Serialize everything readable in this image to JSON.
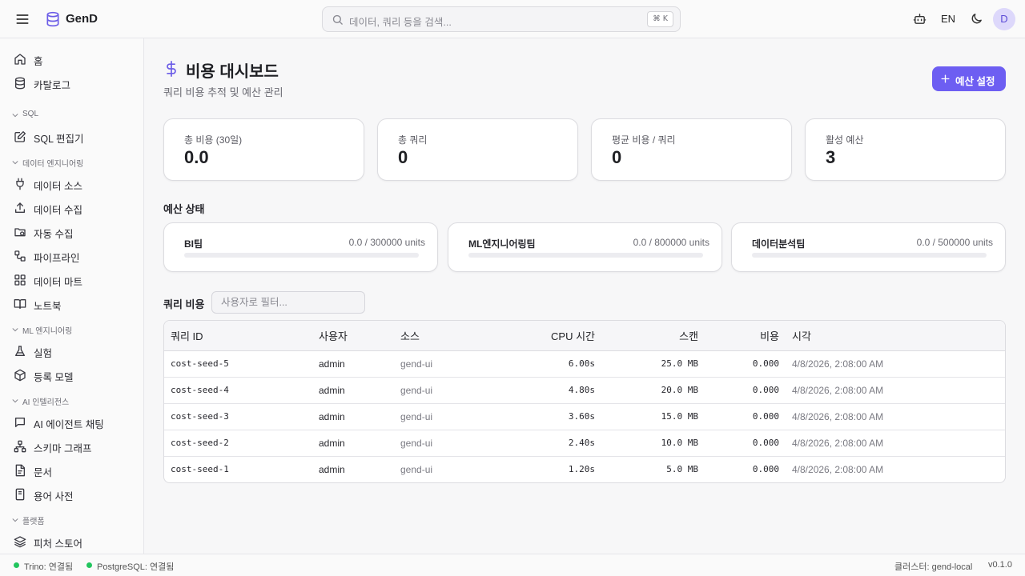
{
  "app": {
    "name": "GenD"
  },
  "search": {
    "placeholder": "데이터, 쿼리 등을 검색...",
    "shortcut": "⌘ K"
  },
  "header": {
    "language": "EN",
    "avatar_initial": "D"
  },
  "sidebar": {
    "home": "홈",
    "catalog": "카탈로그",
    "sections": {
      "sql": "SQL",
      "data_eng": "데이터 엔지니어링",
      "ml_eng": "ML 엔지니어링",
      "ai": "AI 인텔리전스",
      "platform": "플랫폼"
    },
    "sql_editor": "SQL 편집기",
    "data_sources": "데이터 소스",
    "data_ingest": "데이터 수집",
    "auto_ingest": "자동 수집",
    "pipelines": "파이프라인",
    "data_marts": "데이터 마트",
    "notebooks": "노트북",
    "experiments": "실험",
    "registered_models": "등록 모델",
    "ai_agent_chat": "AI 에이전트 채팅",
    "schema_graph": "스키마 그래프",
    "documents": "문서",
    "glossary": "용어 사전",
    "feature_store": "피처 스토어"
  },
  "page": {
    "title": "비용 대시보드",
    "subtitle": "쿼리 비용 추적 및 예산 관리",
    "budget_button": "예산 설정"
  },
  "stats": [
    {
      "label": "총 비용 (30일)",
      "value": "0.0"
    },
    {
      "label": "총 쿼리",
      "value": "0"
    },
    {
      "label": "평균 비용 / 쿼리",
      "value": "0"
    },
    {
      "label": "활성 예산",
      "value": "3"
    }
  ],
  "budget_section": {
    "title": "예산 상태",
    "budgets": [
      {
        "name": "BI팀",
        "usage": "0.0 / 300000 units",
        "fraction": 0.0
      },
      {
        "name": "ML엔지니어링팀",
        "usage": "0.0 / 800000 units",
        "fraction": 0.0
      },
      {
        "name": "데이터분석팀",
        "usage": "0.0 / 500000 units",
        "fraction": 0.0
      }
    ]
  },
  "query_costs": {
    "title": "쿼리 비용",
    "filter_placeholder": "사용자로 필터...",
    "columns": [
      "쿼리 ID",
      "사용자",
      "소스",
      "CPU 시간",
      "스캔",
      "비용",
      "시각"
    ],
    "rows": [
      {
        "id": "cost-seed-5",
        "user": "admin",
        "source": "gend-ui",
        "cpu": "6.00s",
        "scan": "25.0 MB",
        "cost": "0.000",
        "time": "4/8/2026, 2:08:00 AM"
      },
      {
        "id": "cost-seed-4",
        "user": "admin",
        "source": "gend-ui",
        "cpu": "4.80s",
        "scan": "20.0 MB",
        "cost": "0.000",
        "time": "4/8/2026, 2:08:00 AM"
      },
      {
        "id": "cost-seed-3",
        "user": "admin",
        "source": "gend-ui",
        "cpu": "3.60s",
        "scan": "15.0 MB",
        "cost": "0.000",
        "time": "4/8/2026, 2:08:00 AM"
      },
      {
        "id": "cost-seed-2",
        "user": "admin",
        "source": "gend-ui",
        "cpu": "2.40s",
        "scan": "10.0 MB",
        "cost": "0.000",
        "time": "4/8/2026, 2:08:00 AM"
      },
      {
        "id": "cost-seed-1",
        "user": "admin",
        "source": "gend-ui",
        "cpu": "1.20s",
        "scan": "5.0 MB",
        "cost": "0.000",
        "time": "4/8/2026, 2:08:00 AM"
      }
    ]
  },
  "footer": {
    "trino": "Trino: 연결됨",
    "postgres": "PostgreSQL: 연결됨",
    "cluster": "클러스터: gend-local",
    "version": "v0.1.0"
  },
  "colors": {
    "accent": "#6d5ef2",
    "status_ok": "#22c55e"
  },
  "icons": {
    "menu": "menu-icon",
    "logo": "database-icon",
    "search": "search-icon",
    "bot": "bot-icon",
    "theme": "moon-icon",
    "dollar": "dollar-icon",
    "plus": "plus-icon"
  }
}
